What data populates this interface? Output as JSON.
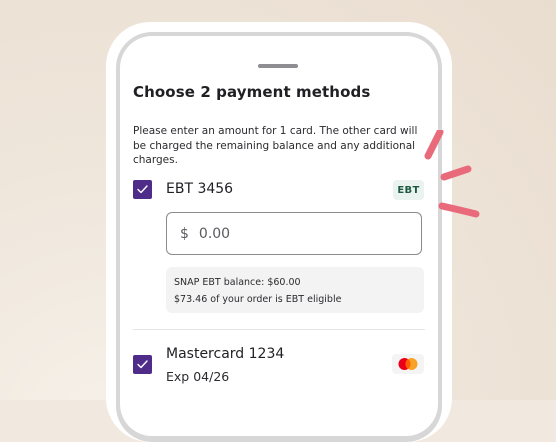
{
  "sheet": {
    "title": "Choose 2 payment methods",
    "instructions": "Please enter an amount for 1 card. The other card will be charged the remaining balance and any additional charges."
  },
  "methods": [
    {
      "name": "EBT 3456",
      "checked": true,
      "badge": "EBT",
      "amount": {
        "currency_symbol": "$",
        "placeholder": "0.00"
      },
      "info": {
        "balance": "SNAP EBT balance: $60.00",
        "eligible": "$73.46 of your order is EBT eligible"
      }
    },
    {
      "name": "Mastercard 1234",
      "checked": true,
      "expiry": "Exp 04/26",
      "logo": "mastercard-logo-icon"
    }
  ],
  "colors": {
    "background": "#f1e9df",
    "checkbox": "#4f2c8a",
    "ebt_badge_text": "#1c5a43",
    "ebt_badge_bg": "#eaf3ef",
    "accent_marks": "#e86a7b",
    "mastercard_red": "#eb001b",
    "mastercard_orange": "#f79e1b"
  }
}
